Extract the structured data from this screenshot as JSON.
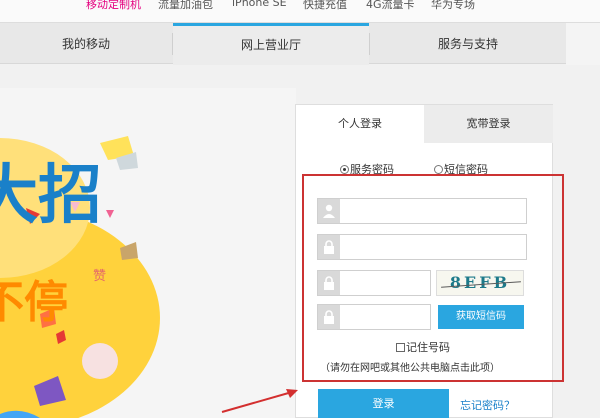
{
  "top_links": [
    {
      "label": "移动定制机",
      "hot": true
    },
    {
      "label": "流量加油包",
      "hot": false
    },
    {
      "label": "iPhone SE",
      "hot": false
    },
    {
      "label": "快捷充值",
      "hot": false
    },
    {
      "label": "4G流量卡",
      "hot": false
    },
    {
      "label": "华为专场",
      "hot": false
    }
  ],
  "nav": {
    "items": [
      "我的移动",
      "网上营业厅",
      "服务与支持"
    ],
    "active": "网上营业厅"
  },
  "banner": {
    "headline": "大招",
    "subline": "不停",
    "badge": "赞"
  },
  "login": {
    "tabs": [
      "个人登录",
      "宽带登录"
    ],
    "active_tab": "个人登录",
    "methods": [
      {
        "label": "服务密码",
        "selected": true
      },
      {
        "label": "短信密码",
        "selected": false
      }
    ],
    "fields": [
      {
        "icon": "user-icon",
        "value": ""
      },
      {
        "icon": "lock-icon",
        "value": ""
      },
      {
        "icon": "lock-icon",
        "value": ""
      },
      {
        "icon": "lock-icon",
        "value": ""
      }
    ],
    "captcha": "8EFB",
    "sms_button": "获取短信码",
    "remember_label": "记住号码",
    "hint": "（请勿在网吧或其他公共电脑点击此项）",
    "submit": "登录",
    "forgot": "忘记密码？"
  },
  "colors": {
    "accent": "#2aa6e0",
    "highlight_box": "#cc3333",
    "hot_link": "#e4007f"
  }
}
